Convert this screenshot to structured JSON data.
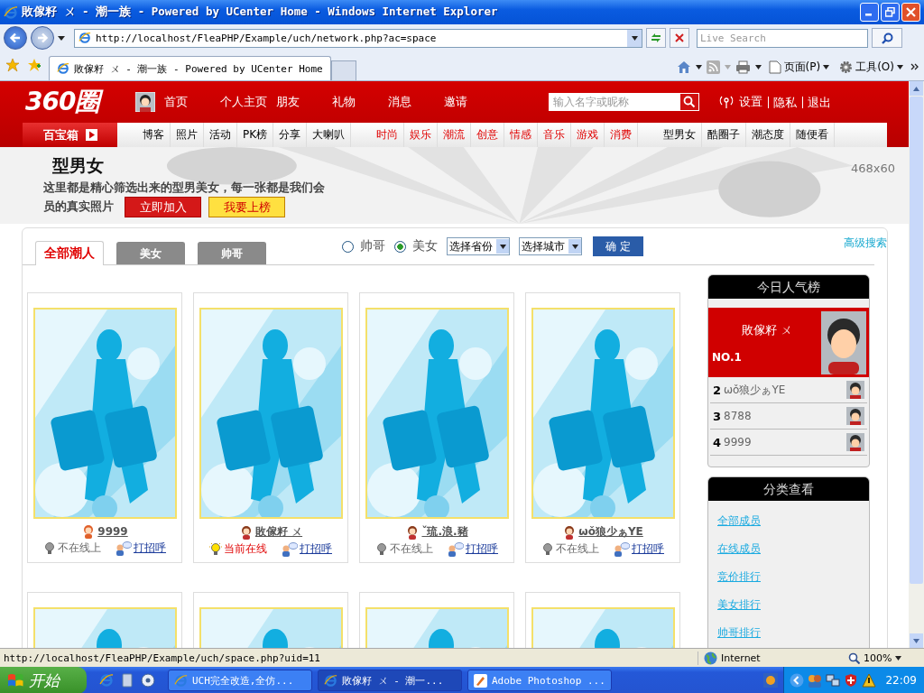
{
  "browser": {
    "title": "敗傢籽 ㄨ - 潮一族 - Powered by UCenter Home - Windows Internet Explorer",
    "address": "http://localhost/FleaPHP/Example/uch/network.php?ac=space",
    "search_placeholder": "Live Search",
    "tabs": [
      {
        "label": "敗傢籽 ㄨ - 潮一族 - Powered by UCenter Home",
        "selected": true
      }
    ],
    "commands": [
      "页面(P)",
      "工具(O)"
    ]
  },
  "site": {
    "logo": "360圈",
    "nav": [
      "首页",
      "个人主页",
      "朋友",
      "礼物",
      "消息",
      "邀请"
    ],
    "search_placeholder": "输入名字或昵称",
    "account_links": [
      "设置",
      "隐私",
      "退出"
    ],
    "toolbox": "百宝箱",
    "subnav_groups": [
      {
        "kind": "plain",
        "items": [
          "博客",
          "照片",
          "活动",
          "PK榜",
          "分享",
          "大喇叭"
        ]
      },
      {
        "kind": "hot",
        "items": [
          "时尚",
          "娱乐",
          "潮流",
          "创意",
          "情感",
          "音乐",
          "游戏",
          "消费"
        ]
      },
      {
        "kind": "plain",
        "items": [
          "型男女",
          "酷圈子",
          "潮态度",
          "随便看"
        ]
      }
    ]
  },
  "banner": {
    "title": "型男女",
    "text_lines": [
      "这里都是精心筛选出来的型男美女，每一张都是我们会",
      "员的真实照片"
    ],
    "join": "立即加入",
    "rank": "我要上榜",
    "ad_size": "468x60"
  },
  "filter": {
    "tabs": [
      {
        "label": "全部潮人",
        "selected": true
      },
      {
        "label": "美女",
        "selected": false
      },
      {
        "label": "帅哥",
        "selected": false
      }
    ],
    "gender": [
      {
        "label": "帅哥",
        "selected": false
      },
      {
        "label": "美女",
        "selected": true
      }
    ],
    "selects": [
      "选择省份",
      "选择城市"
    ],
    "confirm": "确 定",
    "advanced": "高级搜索"
  },
  "cards": [
    {
      "name": "9999",
      "online": false,
      "status": "不在线上",
      "greet": "打招呼"
    },
    {
      "name": "敗傢籽 ㄨ",
      "online": true,
      "status": "当前在线",
      "greet": "打招呼"
    },
    {
      "name": "ˇ琉.浪.豬",
      "online": false,
      "status": "不在线上",
      "greet": "打招呼"
    },
    {
      "name": "ωǒ狼少ぁYE",
      "online": false,
      "status": "不在线上",
      "greet": "打招呼"
    }
  ],
  "ranking": {
    "title": "今日人气榜",
    "top": {
      "name": "敗傢籽 ㄨ",
      "rank": "NO.1"
    },
    "rows": [
      {
        "rank": "2",
        "name": "ωǒ狼少ぁYE"
      },
      {
        "rank": "3",
        "name": "8788"
      },
      {
        "rank": "4",
        "name": "9999"
      }
    ]
  },
  "categories": {
    "title": "分类查看",
    "links": [
      "全部成员",
      "在线成员",
      "竞价排行",
      "美女排行",
      "帅哥排行"
    ]
  },
  "status_bar": {
    "url": "http://localhost/FleaPHP/Example/uch/space.php?uid=11",
    "zone": "Internet",
    "zoom": "100%"
  },
  "taskbar": {
    "start": "开始",
    "tasks": [
      {
        "label": "UCH完全改造,全仿...",
        "selected": false
      },
      {
        "label": "敗傢籽 ㄨ - 潮一...",
        "selected": true
      },
      {
        "label": "Adobe Photoshop ...",
        "selected": false
      }
    ],
    "clock": "22:09"
  }
}
